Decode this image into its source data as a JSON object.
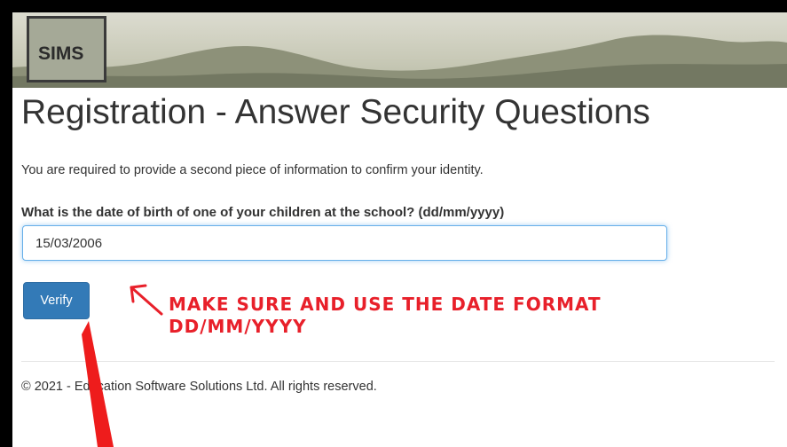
{
  "header": {
    "logo_text": "SIMS"
  },
  "page": {
    "title": "Registration - Answer Security Questions",
    "intro": "You are required to provide a second piece of information to confirm your identity."
  },
  "form": {
    "question_label": "What is the date of birth of one of your children at the school? (dd/mm/yyyy)",
    "answer_value": "15/03/2006",
    "submit_label": "Verify"
  },
  "footer": {
    "copyright": "© 2021 - Education Software Solutions Ltd. All rights reserved."
  },
  "annotation": {
    "line1": "MAKE SURE AND USE THE DATE FORMAT",
    "line2": "DD/MM/YYYY",
    "color": "#e8202a"
  }
}
